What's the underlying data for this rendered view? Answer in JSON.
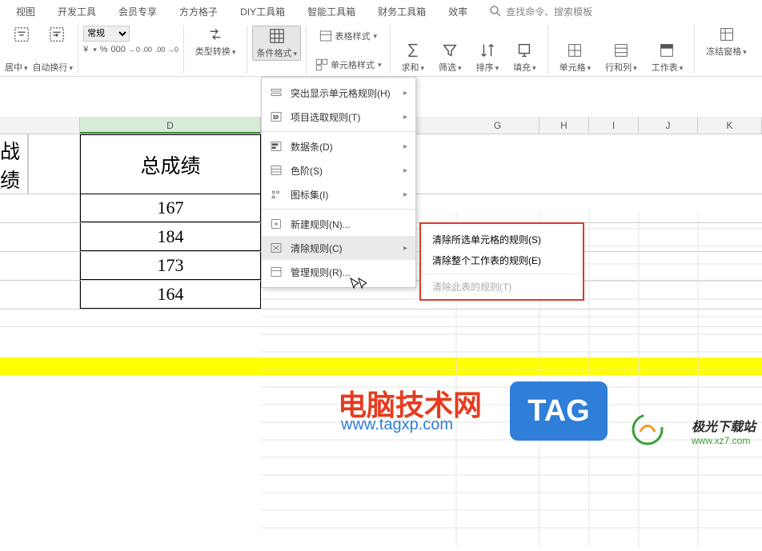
{
  "tabs": [
    "视图",
    "开发工具",
    "会员专享",
    "方方格子",
    "DIY工具箱",
    "智能工具箱",
    "财务工具箱",
    "效率"
  ],
  "search_placeholder": "查找命令、搜索模板",
  "ribbon": {
    "align_center": "居中",
    "wrap": "自动换行",
    "style_default": "常规",
    "currency": "¥",
    "percent": "%",
    "comma": "000",
    "inc_dec1": "←0 .00",
    "inc_dec2": ".00 →0",
    "type_convert": "类型转换",
    "cond_format": "条件格式",
    "table_style": "表格样式",
    "cell_style": "单元格样式",
    "sum": "求和",
    "filter": "筛选",
    "sort": "排序",
    "fill": "填充",
    "cells": "单元格",
    "rowcol": "行和列",
    "sheet": "工作表",
    "freeze": "冻结窗格"
  },
  "columns": {
    "A_width": 100,
    "D": "D",
    "G": "G",
    "H": "H",
    "I": "I",
    "J": "J",
    "K": "K"
  },
  "sheet": {
    "header_partial": "战绩",
    "header_total": "总成绩",
    "rows": [
      "167",
      "184",
      "173",
      "164"
    ]
  },
  "menu": {
    "highlight": "突出显示单元格规则(H)",
    "top": "项目选取规则(T)",
    "databar": "数据条(D)",
    "colorscale": "色阶(S)",
    "iconset": "图标集(I)",
    "new": "新建规则(N)...",
    "clear": "清除规则(C)",
    "manage": "管理规则(R)..."
  },
  "submenu": {
    "sel": "清除所选单元格的规则(S)",
    "sheet": "清除整个工作表的规则(E)",
    "table": "清除此表的规则(T)"
  },
  "watermarks": {
    "site1": "电脑技术网",
    "site1_url": "www.tagxp.com",
    "tag": "TAG",
    "site2": "极光下载站",
    "site2_url": "www.xz7.com"
  }
}
